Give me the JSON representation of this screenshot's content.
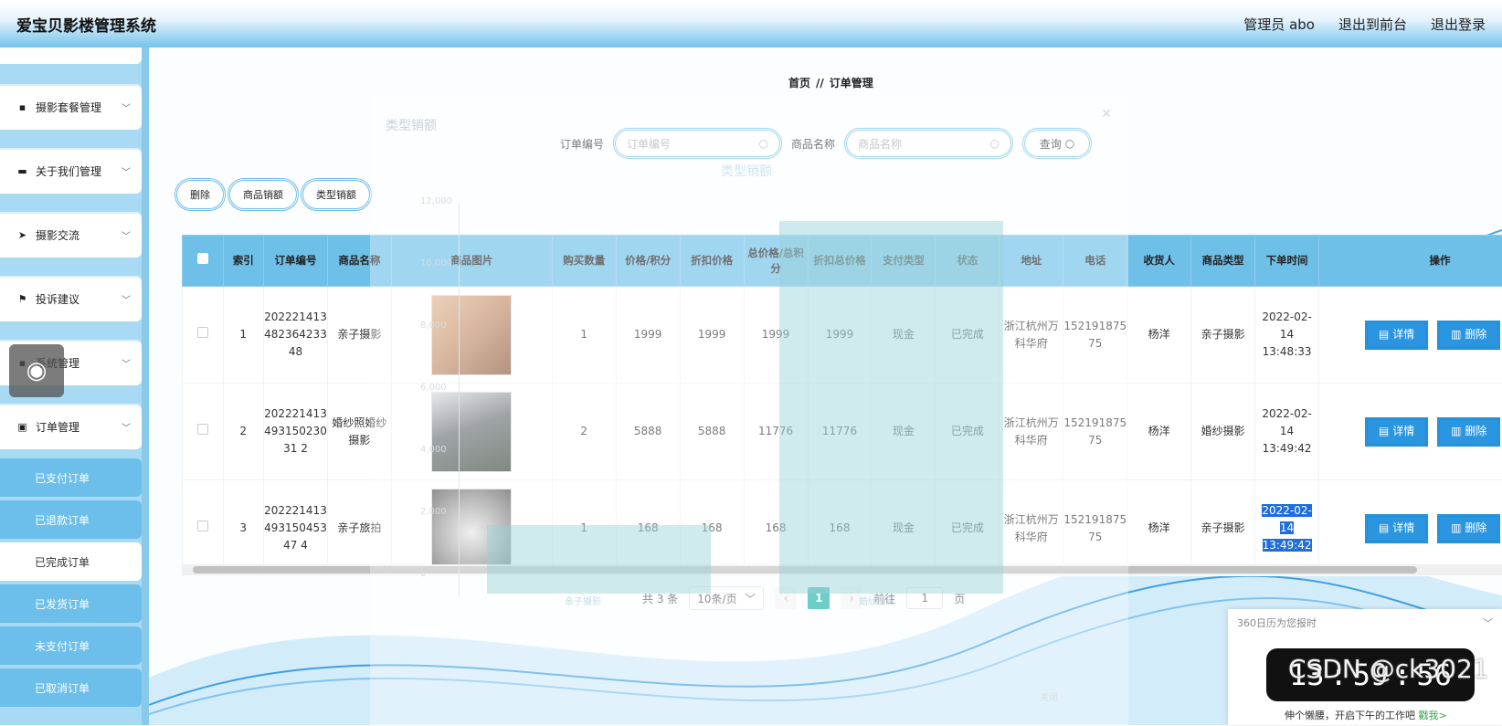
{
  "header": {
    "brand": "爱宝贝影楼管理系统",
    "admin": "管理员 abo",
    "front": "退出到前台",
    "logout": "退出登录"
  },
  "sidebar": {
    "menus": [
      {
        "label": "摄影套餐管理",
        "icon": "briefcase-icon",
        "glyph": "▪"
      },
      {
        "label": "关于我们管理",
        "icon": "book-icon",
        "glyph": "▬"
      },
      {
        "label": "摄影交流",
        "icon": "send-icon",
        "glyph": "➤"
      },
      {
        "label": "投诉建议",
        "icon": "flag-icon",
        "glyph": "⚑"
      },
      {
        "label": "系统管理",
        "icon": "system-icon",
        "glyph": "▪"
      },
      {
        "label": "订单管理",
        "icon": "clipboard-icon",
        "glyph": "▣"
      }
    ],
    "subs": [
      "已支付订单",
      "已退款订单",
      "已完成订单",
      "已发货订单",
      "未支付订单",
      "已取消订单"
    ]
  },
  "breadcrumb": {
    "home": "首页",
    "sep": "//",
    "current": "订单管理"
  },
  "search": {
    "order_label": "订单编号",
    "order_placeholder": "订单编号",
    "product_label": "商品名称",
    "product_placeholder": "商品名称",
    "query": "查询"
  },
  "actions": {
    "delete": "删除",
    "product_sales": "商品销额",
    "type_sales": "类型销额"
  },
  "table": {
    "headers": [
      "索引",
      "订单编号",
      "商品名称",
      "商品图片",
      "购买数量",
      "价格/积分",
      "折扣价格",
      "总价格/总积分",
      "折扣总价格",
      "支付类型",
      "状态",
      "地址",
      "电话",
      "收货人",
      "商品类型",
      "下单时间",
      "操作"
    ],
    "rows": [
      {
        "index": "1",
        "order": "20222141348236423348",
        "name": "亲子摄影",
        "qty": "1",
        "price": "1999",
        "disc": "1999",
        "total": "1999",
        "disc_total": "1999",
        "pay": "现金",
        "status": "已完成",
        "addr": "浙江杭州万科华府",
        "phone": "15219187575",
        "receiver": "杨洋",
        "type": "亲子摄影",
        "time": "2022-02-14 13:48:33"
      },
      {
        "index": "2",
        "order": "20222141349315023031 2",
        "name": "婚纱照婚纱摄影",
        "qty": "2",
        "price": "5888",
        "disc": "5888",
        "total": "11776",
        "disc_total": "11776",
        "pay": "现金",
        "status": "已完成",
        "addr": "浙江杭州万科华府",
        "phone": "15219187575",
        "receiver": "杨洋",
        "type": "婚纱摄影",
        "time": "2022-02-14 13:49:42"
      },
      {
        "index": "3",
        "order": "20222141349315045347 4",
        "name": "亲子旅拍",
        "qty": "1",
        "price": "168",
        "disc": "168",
        "total": "168",
        "disc_total": "168",
        "pay": "现金",
        "status": "已完成",
        "addr": "浙江杭州万科华府",
        "phone": "15219187575",
        "receiver": "杨洋",
        "type": "亲子摄影",
        "time": "2022-02-14 13:49:42"
      }
    ],
    "detail": "详情",
    "delete": "删除"
  },
  "pager": {
    "total": "共 3 条",
    "size": "10条/页",
    "page": "1",
    "goto": "前往",
    "goto_value": "1",
    "unit": "页"
  },
  "dialog": {
    "title": "类型销额",
    "chart_title": "类型销额",
    "y_ticks": [
      "12,000",
      "10,000",
      "8,000",
      "6,000",
      "4,000",
      "2,000",
      "0"
    ],
    "x_labels": [
      "亲子摄影",
      "婚纱摄影"
    ],
    "close_label": "关闭"
  },
  "chart_data": {
    "type": "bar",
    "title": "类型销额",
    "categories": [
      "亲子摄影",
      "婚纱摄影"
    ],
    "values": [
      2167,
      11776
    ],
    "ylim": [
      0,
      12000
    ]
  },
  "clock": {
    "title": "360日历为您报时",
    "h": "13",
    "m": "59",
    "s": "56",
    "footer": "伸个懒腰，开启下午的工作吧",
    "link": "戳我>"
  },
  "watermark": "CSDN @ck3021"
}
